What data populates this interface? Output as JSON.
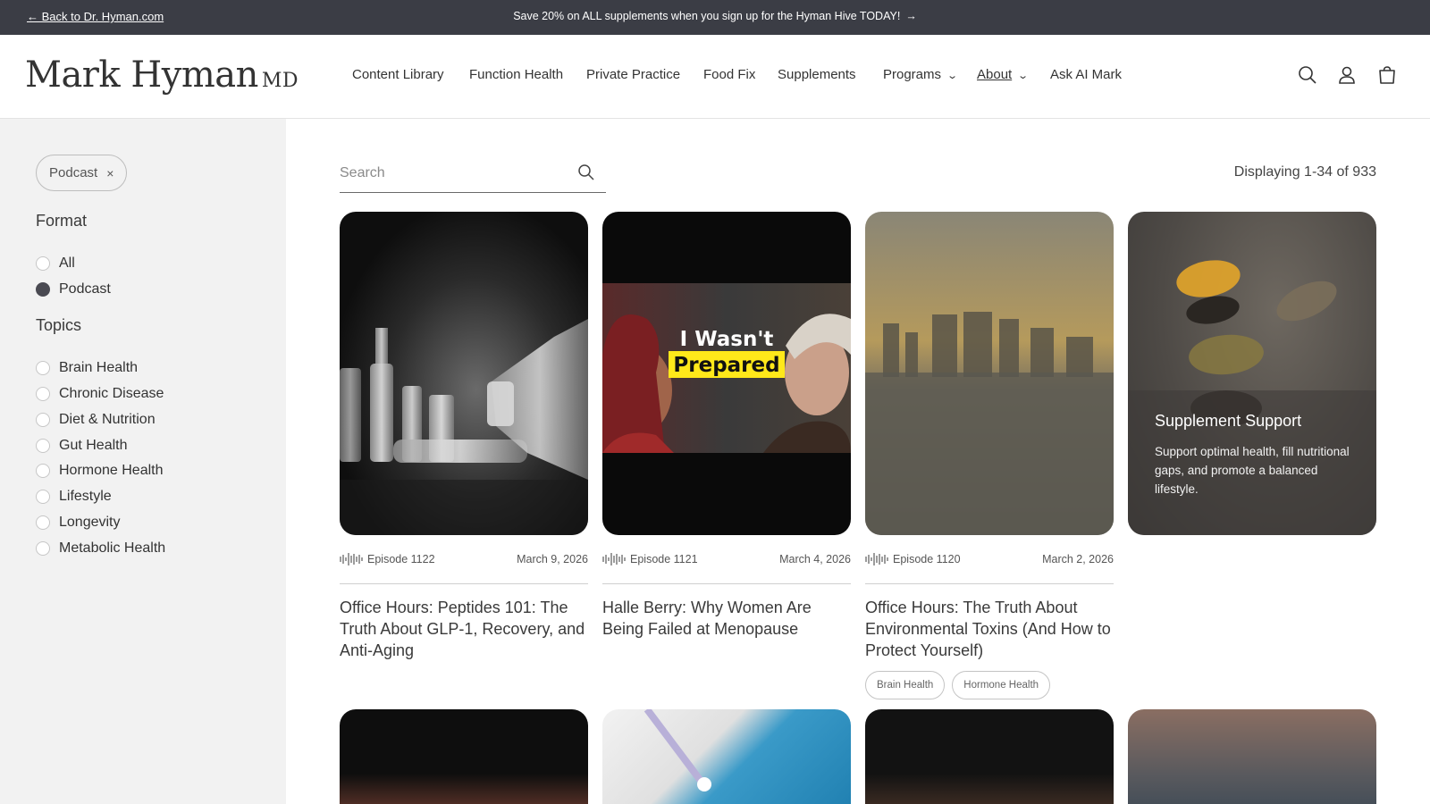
{
  "topbar": {
    "back_link": "← Back to Dr. Hyman.com",
    "promo": "Save 20% on ALL supplements when you sign up for the Hyman Hive TODAY!",
    "promo_arrow": "→"
  },
  "header": {
    "logo_name": "Mark Hyman",
    "logo_suffix": "MD",
    "nav": [
      {
        "label": "Content Library"
      },
      {
        "label": "Function Health"
      },
      {
        "label": "Private Practice"
      },
      {
        "label": "Food Fix"
      },
      {
        "label": "Supplements"
      },
      {
        "label": "Programs",
        "dropdown": true
      },
      {
        "label": "About",
        "dropdown": true,
        "active": true
      },
      {
        "label": "Ask AI Mark"
      }
    ],
    "icons": [
      "search-icon",
      "account-icon",
      "cart-icon"
    ]
  },
  "sidebar": {
    "active_filter": "Podcast",
    "active_filter_remove": "×",
    "format_heading": "Format",
    "format_options": [
      {
        "label": "All",
        "selected": false
      },
      {
        "label": "Podcast",
        "selected": true
      }
    ],
    "topics_heading": "Topics",
    "topics": [
      {
        "label": "Brain Health"
      },
      {
        "label": "Chronic Disease"
      },
      {
        "label": "Diet & Nutrition"
      },
      {
        "label": "Gut Health"
      },
      {
        "label": "Hormone Health"
      },
      {
        "label": "Lifestyle"
      },
      {
        "label": "Longevity"
      },
      {
        "label": "Metabolic Health"
      }
    ]
  },
  "main": {
    "search_placeholder": "Search",
    "count_text": "Displaying 1-34 of 933",
    "cards": [
      {
        "episode": "Episode 1122",
        "date": "March 9, 2026",
        "title": "Office Hours: Peptides 101: The Truth About GLP-1, Recovery, and Anti-Aging",
        "tags": []
      },
      {
        "episode": "Episode 1121",
        "date": "March 4, 2026",
        "title": "Halle Berry: Why Women Are Being Failed at Menopause",
        "thumb_text_line1": "I Wasn't",
        "thumb_text_line2": "Prepared",
        "tags": []
      },
      {
        "episode": "Episode 1120",
        "date": "March 2, 2026",
        "title": "Office Hours: The Truth About Environmental Toxins (And How to Protect Yourself)",
        "tags": [
          "Brain Health",
          "Hormone Health"
        ]
      }
    ],
    "promo_card": {
      "title": "Supplement Support",
      "body": "Support optimal health, fill nutritional gaps, and promote a balanced lifestyle."
    }
  },
  "colors": {
    "topbar": "#3b3d45",
    "sidebar": "#f2f2f2",
    "radio_selected": "#4a4a52"
  }
}
